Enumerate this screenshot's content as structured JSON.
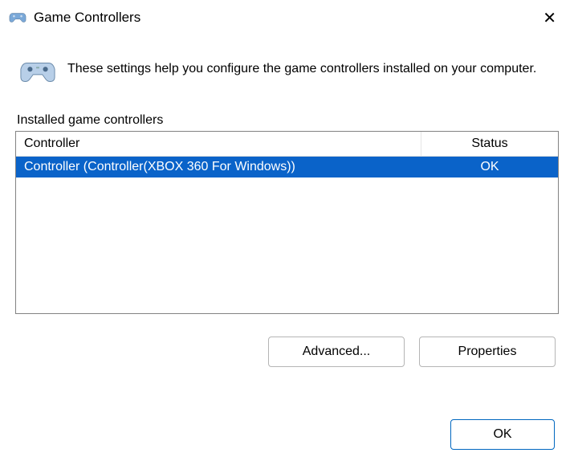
{
  "window": {
    "title": "Game Controllers"
  },
  "info": {
    "text": "These settings help you configure the game controllers installed on your computer."
  },
  "group": {
    "label": "Installed game controllers",
    "columns": {
      "controller": "Controller",
      "status": "Status"
    },
    "rows": [
      {
        "controller": "Controller (Controller(XBOX 360 For Windows))",
        "status": "OK",
        "selected": true
      }
    ]
  },
  "buttons": {
    "advanced": "Advanced...",
    "properties": "Properties",
    "ok": "OK"
  }
}
